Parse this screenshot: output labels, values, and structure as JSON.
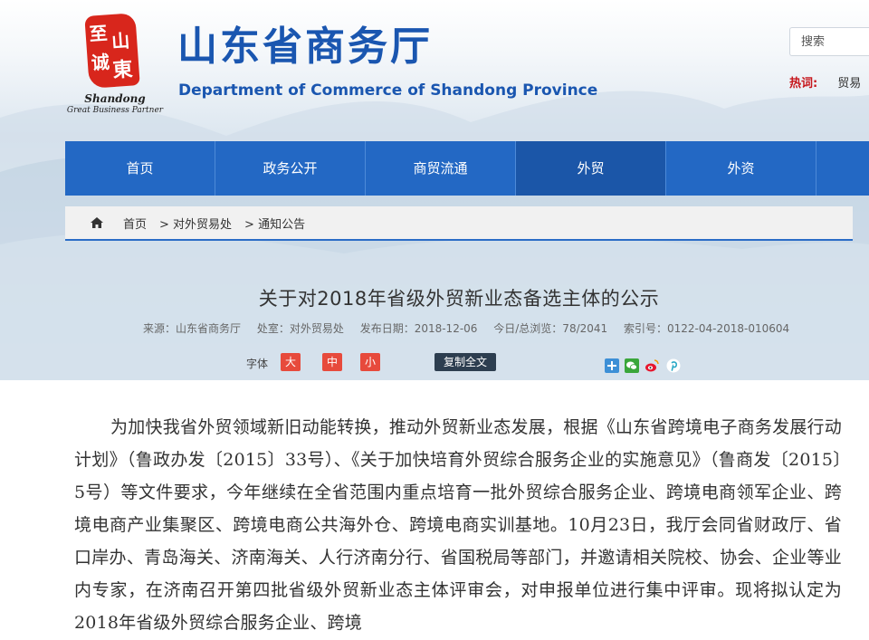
{
  "header": {
    "seal_chars": [
      "至",
      "诚",
      "山",
      "東"
    ],
    "brand_line1": "Shandong",
    "brand_line2": "Great Business Partner",
    "site_title": "山东省商务厅",
    "site_subtitle": "Department of Commerce of Shandong Province",
    "search_placeholder": "搜索",
    "hot_label": "热词:",
    "hot_value": "贸易",
    "colors": {
      "brand_blue": "#1a56b0",
      "nav_blue": "#2368c4",
      "seal_red": "#d8261c"
    }
  },
  "nav": {
    "items": [
      {
        "label": "首页"
      },
      {
        "label": "政务公开"
      },
      {
        "label": "商贸流通"
      },
      {
        "label": "外贸"
      },
      {
        "label": "外资"
      }
    ],
    "active": "外贸"
  },
  "breadcrumb": {
    "icon": "home-icon",
    "items": [
      "首页",
      "> 对外贸易处",
      "> 通知公告"
    ]
  },
  "article": {
    "title": "关于对2018年省级外贸新业态备选主体的公示",
    "meta": {
      "source": "来源：山东省商务厅",
      "office": "处室：对外贸易处",
      "date": "发布日期：2018-12-06",
      "views": "今日/总浏览：78/2041",
      "index": "索引号：0122-04-2018-010604"
    },
    "font_label": "字体",
    "font_sizes": [
      "大",
      "中",
      "小"
    ],
    "copy_label": "复制全文",
    "share_icons": [
      "plus-share-icon",
      "wechat-icon",
      "weibo-icon",
      "pinterest-icon"
    ],
    "body": "为加快我省外贸领域新旧动能转换，推动外贸新业态发展，根据《山东省跨境电子商务发展行动计划》（鲁政办发〔2015〕33号）、《关于加快培育外贸综合服务企业的实施意见》（鲁商发〔2015〕5号）等文件要求，今年继续在全省范围内重点培育一批外贸综合服务企业、跨境电商领军企业、跨境电商产业集聚区、跨境电商公共海外仓、跨境电商实训基地。10月23日，我厅会同省财政厅、省口岸办、青岛海关、济南海关、人行济南分行、省国税局等部门，并邀请相关院校、协会、企业等业内专家，在济南召开第四批省级外贸新业态主体评审会，对申报单位进行集中评审。现将拟认定为2018年省级外贸综合服务企业、跨境"
  }
}
